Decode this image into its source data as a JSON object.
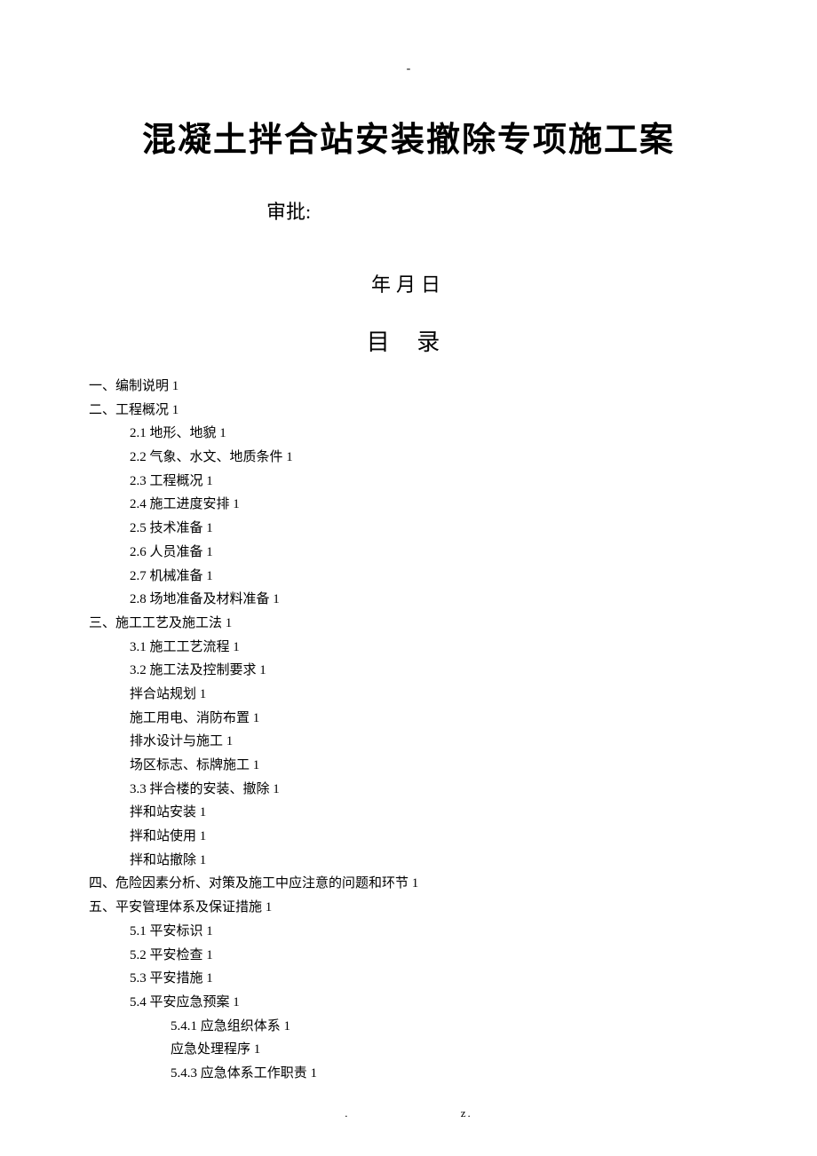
{
  "top_marker": "-",
  "title": "混凝土拌合站安装撤除专项施工案",
  "approval_label": "审批:",
  "date_label": "年月日",
  "toc_heading": "目 录",
  "toc": [
    {
      "text": "一、编制说明 1",
      "indent": 0
    },
    {
      "text": "二、工程概况 1",
      "indent": 0
    },
    {
      "text": "2.1 地形、地貌 1",
      "indent": 1
    },
    {
      "text": "2.2 气象、水文、地质条件 1",
      "indent": 1
    },
    {
      "text": "2.3 工程概况 1",
      "indent": 1
    },
    {
      "text": "2.4 施工进度安排 1",
      "indent": 1
    },
    {
      "text": "2.5 技术准备 1",
      "indent": 1
    },
    {
      "text": "2.6 人员准备 1",
      "indent": 1
    },
    {
      "text": "2.7 机械准备 1",
      "indent": 1
    },
    {
      "text": "2.8 场地准备及材料准备 1",
      "indent": 1
    },
    {
      "text": "三、施工工艺及施工法 1",
      "indent": 0
    },
    {
      "text": "3.1 施工工艺流程 1",
      "indent": 1
    },
    {
      "text": "3.2 施工法及控制要求 1",
      "indent": 1
    },
    {
      "text": "拌合站规划 1",
      "indent": 1
    },
    {
      "text": "施工用电、消防布置 1",
      "indent": 1
    },
    {
      "text": "排水设计与施工 1",
      "indent": 1
    },
    {
      "text": "场区标志、标牌施工 1",
      "indent": 1
    },
    {
      "text": "3.3 拌合楼的安装、撤除 1",
      "indent": 1
    },
    {
      "text": "拌和站安装 1",
      "indent": 1
    },
    {
      "text": "拌和站使用 1",
      "indent": 1
    },
    {
      "text": "拌和站撤除 1",
      "indent": 1
    },
    {
      "text": "四、危险因素分析、对策及施工中应注意的问题和环节 1",
      "indent": 0
    },
    {
      "text": "五、平安管理体系及保证措施 1",
      "indent": 0
    },
    {
      "text": "5.1 平安标识 1",
      "indent": 1
    },
    {
      "text": "5.2 平安检查 1",
      "indent": 1
    },
    {
      "text": "5.3 平安措施 1",
      "indent": 1
    },
    {
      "text": "5.4 平安应急预案 1",
      "indent": 1
    },
    {
      "text": "5.4.1 应急组织体系 1",
      "indent": 2
    },
    {
      "text": "应急处理程序 1",
      "indent": 2
    },
    {
      "text": "5.4.3 应急体系工作职责 1",
      "indent": 2
    }
  ],
  "footer_left": ".",
  "footer_right": "z."
}
